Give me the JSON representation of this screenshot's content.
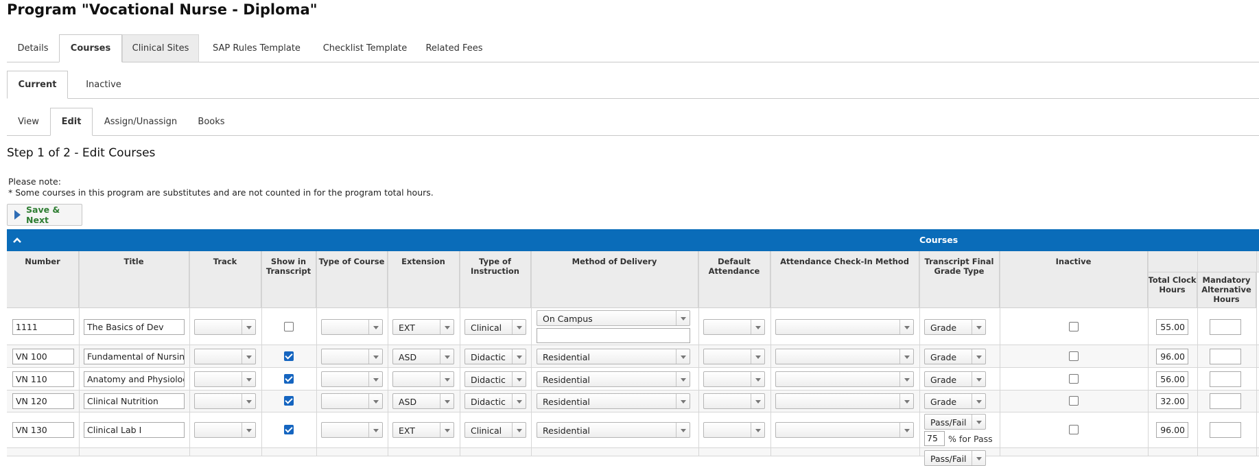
{
  "page_title": "Program \"Vocational Nurse - Diploma\"",
  "main_tabs": [
    "Details",
    "Courses",
    "Clinical Sites",
    "SAP Rules Template",
    "Checklist Template",
    "Related Fees"
  ],
  "status_tabs": [
    "Current",
    "Inactive"
  ],
  "mode_tabs": [
    "View",
    "Edit",
    "Assign/Unassign",
    "Books"
  ],
  "step_title": "Step 1 of 2 - Edit Courses",
  "note": {
    "heading": "Please note:",
    "text": "* Some courses in this program are substitutes and are not counted in for the program total hours."
  },
  "save_next_label": "Save & Next",
  "section_title": "Courses",
  "columns": {
    "number": "Number",
    "title": "Title",
    "track": "Track",
    "show_in_transcript": "Show in Transcript",
    "type_of_course": "Type of Course",
    "extension": "Extension",
    "type_of_instruction": "Type of Instruction",
    "method_of_delivery": "Method of Delivery",
    "default_attendance": "Default Attendance",
    "attendance_checkin": "Attendance Check-In Method",
    "transcript_grade_type": "Transcript Final Grade Type",
    "inactive": "Inactive",
    "total_clock_hours": "Total Clock Hours",
    "mandatory_alt_hours": "Mandatory Alternative Hours"
  },
  "rows": [
    {
      "number": "1111",
      "title": "The Basics of Dev",
      "show_in_transcript": false,
      "extension": "EXT",
      "type_of_instruction": "Clinical",
      "method_of_delivery": "On Campus",
      "grade_type": "Grade",
      "inactive": false,
      "total_clock_hours": "55.00",
      "mandatory_alt_hours": ""
    },
    {
      "number": "VN 100",
      "title": "Fundamental of Nursing",
      "show_in_transcript": true,
      "extension": "ASD",
      "type_of_instruction": "Didactic",
      "method_of_delivery": "Residential",
      "grade_type": "Grade",
      "inactive": false,
      "total_clock_hours": "96.00",
      "mandatory_alt_hours": ""
    },
    {
      "number": "VN 110",
      "title": "Anatomy and Physiology",
      "show_in_transcript": true,
      "extension": "",
      "type_of_instruction": "Didactic",
      "method_of_delivery": "Residential",
      "grade_type": "Grade",
      "inactive": false,
      "total_clock_hours": "56.00",
      "mandatory_alt_hours": ""
    },
    {
      "number": "VN 120",
      "title": "Clinical Nutrition",
      "show_in_transcript": true,
      "extension": "ASD",
      "type_of_instruction": "Didactic",
      "method_of_delivery": "Residential",
      "grade_type": "Grade",
      "inactive": false,
      "total_clock_hours": "32.00",
      "mandatory_alt_hours": ""
    },
    {
      "number": "VN 130",
      "title": "Clinical Lab I",
      "show_in_transcript": true,
      "extension": "EXT",
      "type_of_instruction": "Clinical",
      "method_of_delivery": "Residential",
      "grade_type": "Pass/Fail",
      "pass_percent": "75",
      "pass_label": "% for Pass",
      "inactive": false,
      "total_clock_hours": "96.00",
      "mandatory_alt_hours": ""
    }
  ],
  "partial_row": {
    "grade_type": "Pass/Fail"
  }
}
